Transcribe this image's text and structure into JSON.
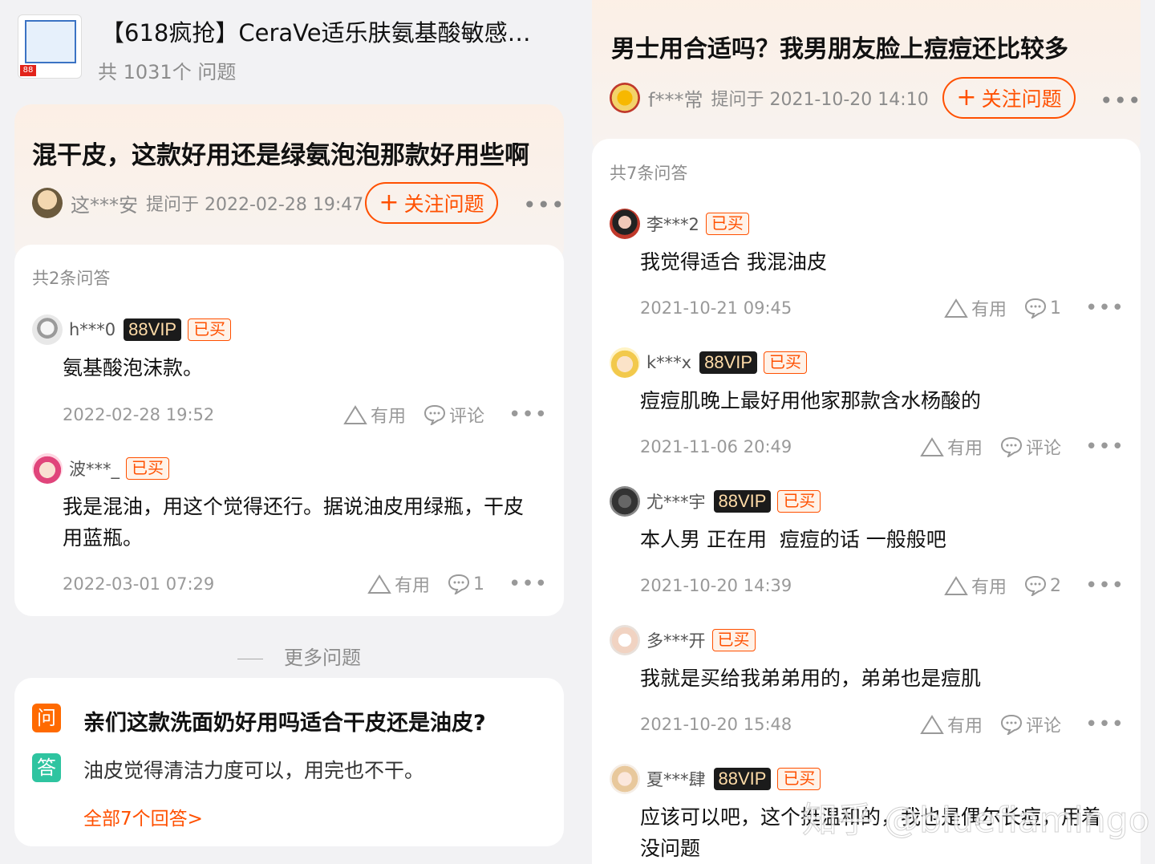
{
  "product": {
    "title": "【618疯抢】CeraVe适乐肤氨基酸敏感…",
    "question_count": "共 1031个 问题",
    "image_tag": "88"
  },
  "left_question": {
    "title": "混干皮，这款好用还是绿氨泡泡那款好用些啊",
    "asker": "这***安",
    "asked_at": "提问于 2022-02-28 19:47",
    "follow_label": "关注问题",
    "answer_count": "共2条问答",
    "answers": [
      {
        "user": "h***0",
        "vip": "88VIP",
        "bought": "已买",
        "text": "氨基酸泡沫款。",
        "date": "2022-02-28 19:52",
        "useful": "有用",
        "comment": "评论"
      },
      {
        "user": "波***_",
        "bought": "已买",
        "text": "我是混油，用这个觉得还行。据说油皮用绿瓶，干皮用蓝瓶。",
        "date": "2022-03-01 07:29",
        "useful": "有用",
        "comment": "1"
      }
    ]
  },
  "more_questions": {
    "title": "更多问题",
    "q_badge": "问",
    "a_badge": "答",
    "question": "亲们这款洗面奶好用吗适合干皮还是油皮?",
    "answer": "油皮觉得清洁力度可以，用完也不干。",
    "all_answers": "全部7个回答>"
  },
  "right_question": {
    "title": "男士用合适吗？我男朋友脸上痘痘还比较多",
    "asker": "f***常",
    "asked_at": "提问于 2021-10-20 14:10",
    "follow_label": "关注问题",
    "answer_count": "共7条问答",
    "answers": [
      {
        "user": "李***2",
        "bought": "已买",
        "text": "我觉得适合 我混油皮",
        "date": "2021-10-21 09:45",
        "useful": "有用",
        "comment": "1"
      },
      {
        "user": "k***x",
        "vip": "88VIP",
        "bought": "已买",
        "text": "痘痘肌晚上最好用他家那款含水杨酸的",
        "date": "2021-11-06 20:49",
        "useful": "有用",
        "comment": "评论"
      },
      {
        "user": "尤***宇",
        "vip": "88VIP",
        "bought": "已买",
        "text": "本人男 正在用  痘痘的话 一般般吧",
        "date": "2021-10-20 14:39",
        "useful": "有用",
        "comment": "2"
      },
      {
        "user": "多***开",
        "bought": "已买",
        "text": "我就是买给我弟弟用的，弟弟也是痘肌",
        "date": "2021-10-20 15:48",
        "useful": "有用",
        "comment": "评论"
      },
      {
        "user": "夏***肆",
        "vip": "88VIP",
        "bought": "已买",
        "text": "应该可以吧，这个挺温和的，我也是偶尔长痘，用着没问题"
      }
    ]
  },
  "watermark": "知乎 @bluefiamingo",
  "colors": {
    "accent": "#ff5000",
    "vip_bg": "#1b1b1b",
    "vip_text": "#ffdca8",
    "q_badge": "#ff6a00",
    "a_badge": "#2ec4a0"
  }
}
